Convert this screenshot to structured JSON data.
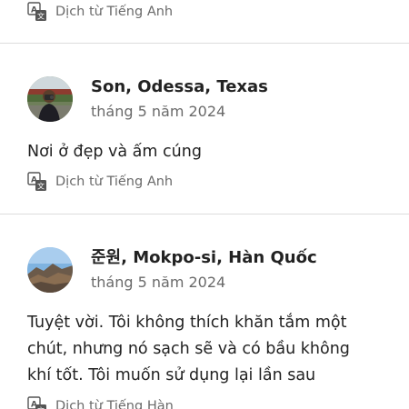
{
  "reviews": [
    {
      "translate_label": "Dịch từ Tiếng Anh"
    },
    {
      "name": "Son, Odessa, Texas",
      "date": "tháng 5 năm 2024",
      "text": "Nơi ở đẹp và ấm cúng",
      "translate_label": "Dịch từ Tiếng Anh"
    },
    {
      "name": "준원, Mokpo-si, Hàn Quốc",
      "date": "tháng 5 năm 2024",
      "text": "Tuyệt vời. Tôi không thích khăn tắm một\nchút, nhưng nó sạch sẽ và có bầu không\nkhí tốt. Tôi muốn sử dụng lại lần sau",
      "translate_label": "Dịch từ Tiếng Hàn"
    }
  ],
  "icons": {
    "translate": "translate-icon",
    "avatar_1": "avatar-photo",
    "avatar_2": "avatar-landscape"
  },
  "colors": {
    "text_primary": "#222222",
    "text_secondary": "#6a6a6a",
    "divider": "#dddddd"
  }
}
